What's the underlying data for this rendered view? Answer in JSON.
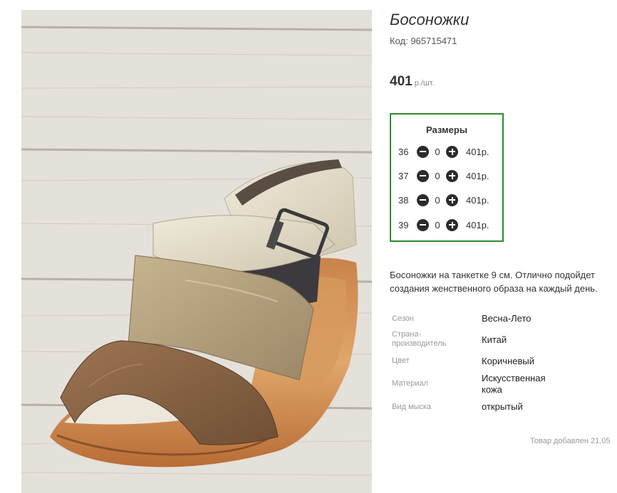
{
  "product": {
    "title": "Босоножки",
    "code": "Код: 965715471",
    "price": "401",
    "price_unit": "р./шт."
  },
  "sizes": {
    "title": "Размеры",
    "rows": [
      {
        "size": "36",
        "qty": "0",
        "sum": "401р."
      },
      {
        "size": "37",
        "qty": "0",
        "sum": "401р."
      },
      {
        "size": "38",
        "qty": "0",
        "sum": "401р."
      },
      {
        "size": "39",
        "qty": "0",
        "sum": "401р."
      }
    ]
  },
  "description": {
    "line1": "Босоножки на танкетке 9 см. Отлично подойдет",
    "line2": "создания женственного образа на каждый день."
  },
  "properties": [
    {
      "label": "Сезон",
      "value": "Весна-Лето"
    },
    {
      "label": "Страна-\nпроизводитель",
      "value": "Китай"
    },
    {
      "label": "Цвет",
      "value": "Коричневый"
    },
    {
      "label": "Материал",
      "value": "Искусственная\nкожа"
    },
    {
      "label": "Вид мыска",
      "value": "открытый"
    }
  ],
  "added_text": "Товар добавлен 21.05",
  "colors": {
    "border_green": "#2e8b2e",
    "button_dark": "#2b2b2b"
  }
}
